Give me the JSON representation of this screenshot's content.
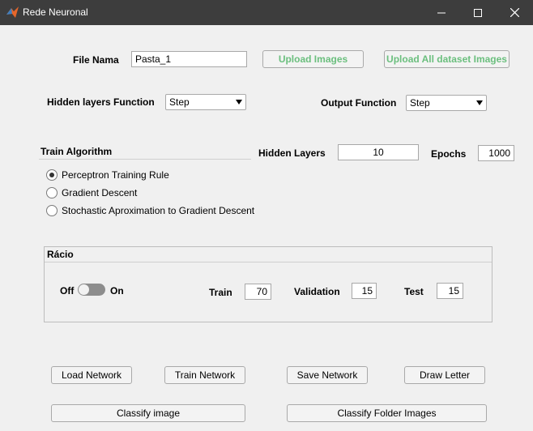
{
  "window": {
    "title": "Rede Neuronal"
  },
  "file": {
    "label": "File Nama",
    "value": "Pasta_1"
  },
  "buttons": {
    "upload_images": "Upload Images",
    "upload_all": "Upload All dataset Images",
    "load_network": "Load Network",
    "train_network": "Train Network",
    "save_network": "Save Network",
    "draw_letter": "Draw Letter",
    "classify_image": "Classify image",
    "classify_folder": "Classify Folder Images"
  },
  "hidden_function": {
    "label": "Hidden layers Function",
    "selected": "Step"
  },
  "output_function": {
    "label": "Output Function",
    "selected": "Step"
  },
  "train_algorithm": {
    "title": "Train Algorithm",
    "options": [
      {
        "label": "Perceptron Training Rule",
        "checked": true
      },
      {
        "label": "Gradient Descent",
        "checked": false
      },
      {
        "label": "Stochastic Aproximation to Gradient Descent",
        "checked": false
      }
    ]
  },
  "hidden_layers": {
    "label": "Hidden Layers",
    "value": "10"
  },
  "epochs": {
    "label": "Epochs",
    "value": "1000"
  },
  "ratio": {
    "title": "Rácio",
    "toggle_off": "Off",
    "toggle_on": "On",
    "toggle_state": "off",
    "train_label": "Train",
    "train_value": "70",
    "validation_label": "Validation",
    "validation_value": "15",
    "test_label": "Test",
    "test_value": "15"
  }
}
